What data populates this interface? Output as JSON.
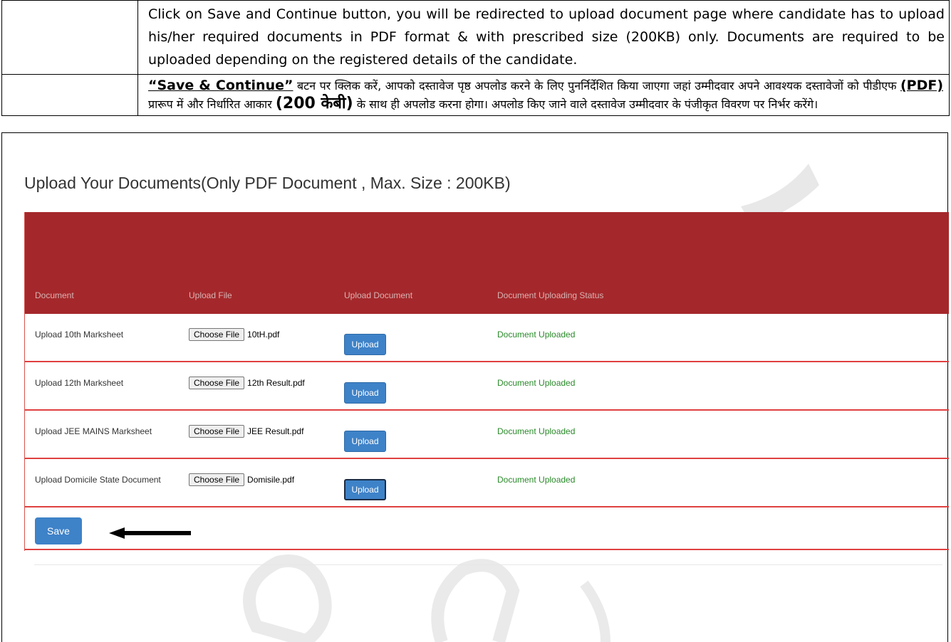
{
  "instructions": {
    "english": "Click on Save and Continue button, you will be redirected to upload document page where candidate has to upload his/her required documents in PDF format & with prescribed size (200KB) only. Documents are required to be uploaded depending on the registered details of the candidate.",
    "hindi_bold": "“Save & Continue”",
    "hindi_part1": " बटन पर क्लिक करें, आपको दस्तावेज पृष्ठ अपलोड करने के लिए पुनर्निर्देशित किया जाएगा जहां उम्मीदवार अपने आवश्यक दस्तावेजों को पीडीएफ ",
    "hindi_pdf": "(PDF)",
    "hindi_part2": " प्रारूप में और निर्धारित आकार ",
    "hindi_size": "(200 केबी)",
    "hindi_part3": " के साथ ही अपलोड करना होगा। अपलोड किए जाने वाले दस्तावेज उम्मीदवार के पंजीकृत विवरण पर निर्भर करेंगे।"
  },
  "upload": {
    "title": "Upload Your Documents(Only PDF Document , Max. Size : 200KB)",
    "columns": [
      "Document",
      "Upload File",
      "Upload Document",
      "Document Uploading Status"
    ],
    "choose_label": "Choose File",
    "upload_label": "Upload",
    "rows": [
      {
        "label": "Upload 10th Marksheet",
        "file": "10tH.pdf",
        "status": "Document Uploaded"
      },
      {
        "label": "Upload 12th Marksheet",
        "file": "12th Result.pdf",
        "status": "Document Uploaded"
      },
      {
        "label": "Upload JEE MAINS Marksheet",
        "file": "JEE Result.pdf",
        "status": "Document Uploaded"
      },
      {
        "label": "Upload Domicile State Document",
        "file": "Domisile.pdf",
        "status": "Document Uploaded"
      }
    ],
    "save_label": "Save"
  },
  "colors": {
    "header": "#a4282b",
    "button": "#3e82c8",
    "status": "#2a8a2a",
    "row_border": "#e04040"
  }
}
